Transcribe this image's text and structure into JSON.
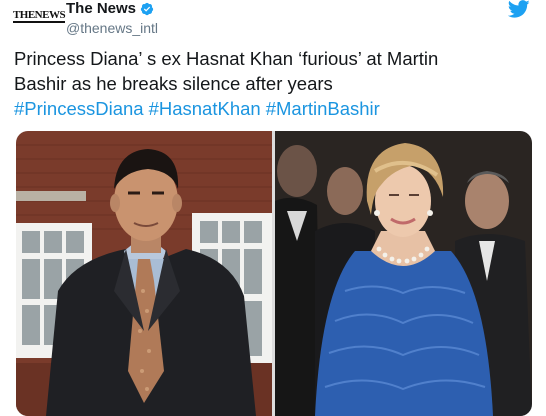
{
  "account": {
    "display_name": "The News",
    "handle": "@thenews_intl",
    "avatar_text": "THENEWS",
    "verified": true
  },
  "tweet": {
    "line1": "Princess Diana’ s ex Hasnat Khan  ‘furious’  at Martin",
    "line2": "Bashir as he breaks silence after years",
    "hashtags": [
      "#PrincessDiana",
      "#HasnatKhan",
      "#MartinBashir"
    ]
  },
  "colors": {
    "link": "#1b95e0",
    "text": "#14171a",
    "secondary": "#657786",
    "twitter_blue": "#1da1f2"
  },
  "media": {
    "photos": [
      {
        "name": "hasnat-khan-photo"
      },
      {
        "name": "princess-diana-photo"
      }
    ]
  }
}
